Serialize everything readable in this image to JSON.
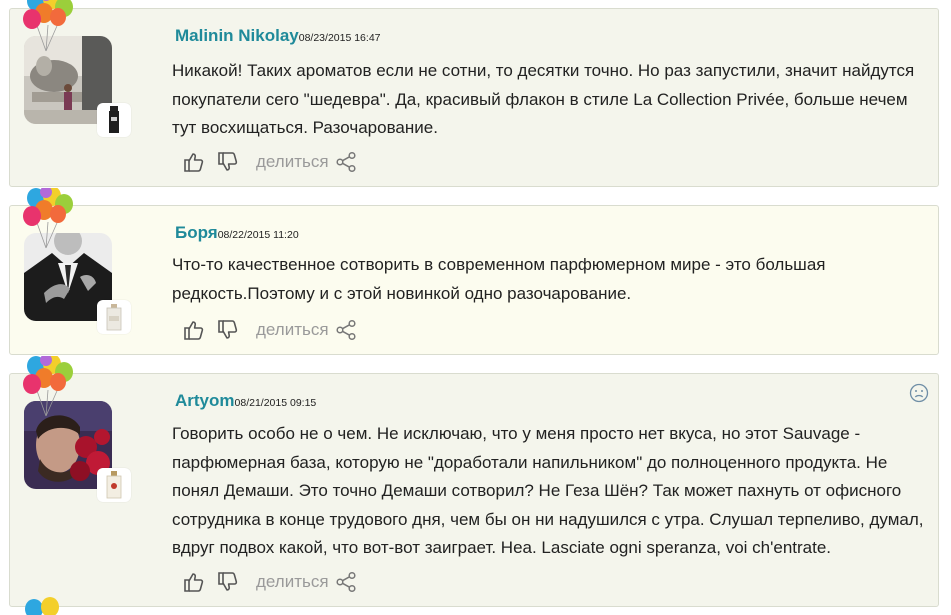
{
  "comments": [
    {
      "author": "Malinin Nikolay",
      "date": "08/23/2015 16:47",
      "text": "Никакой! Таких ароматов если не сотни, то десятки точно. Но раз запустили, значит найдутся покупатели сего \"шедевра\". Да, красивый флакон в стиле La Collection Privée, больше нечем тут восхищаться. Разочарование.",
      "share_label": "делиться"
    },
    {
      "author": "Боря",
      "date": "08/22/2015 11:20",
      "text": "Что-то качественное сотворить в современном парфюмерном мире - это большая редкость.Поэтому и с этой новинкой одно разочарование.",
      "share_label": "делиться"
    },
    {
      "author": "Artyom",
      "date": "08/21/2015 09:15",
      "text": "Говорить особо не о чем. Не исключаю, что у меня просто нет вкуса, но этот Sauvage - парфюмерная база, которую не \"доработали напильником\" до полноценного продукта. Не понял Демаши. Это точно Демаши сотворил? Не Геза Шён? Так может пахнуть от офисного сотрудника в конце трудового дня, чем бы он ни надушился с утра. Слушал терпеливо, думал, вдруг подвох какой, что вот-вот заиграет. Неа. Lasciate ogni speranza, voi ch'entrate.",
      "share_label": "делиться"
    }
  ],
  "icons": {
    "like": "thumbs-up-icon",
    "dislike": "thumbs-down-icon",
    "share": "share-icon",
    "mood": "sad-face-icon",
    "badge": "balloons-icon"
  },
  "colors": {
    "author": "#1f8a9a",
    "card_bg": "#f4f5ec",
    "card_bg_alt": "#fcfcef",
    "card_border": "#d9dccf",
    "muted": "#9a9a9a"
  }
}
